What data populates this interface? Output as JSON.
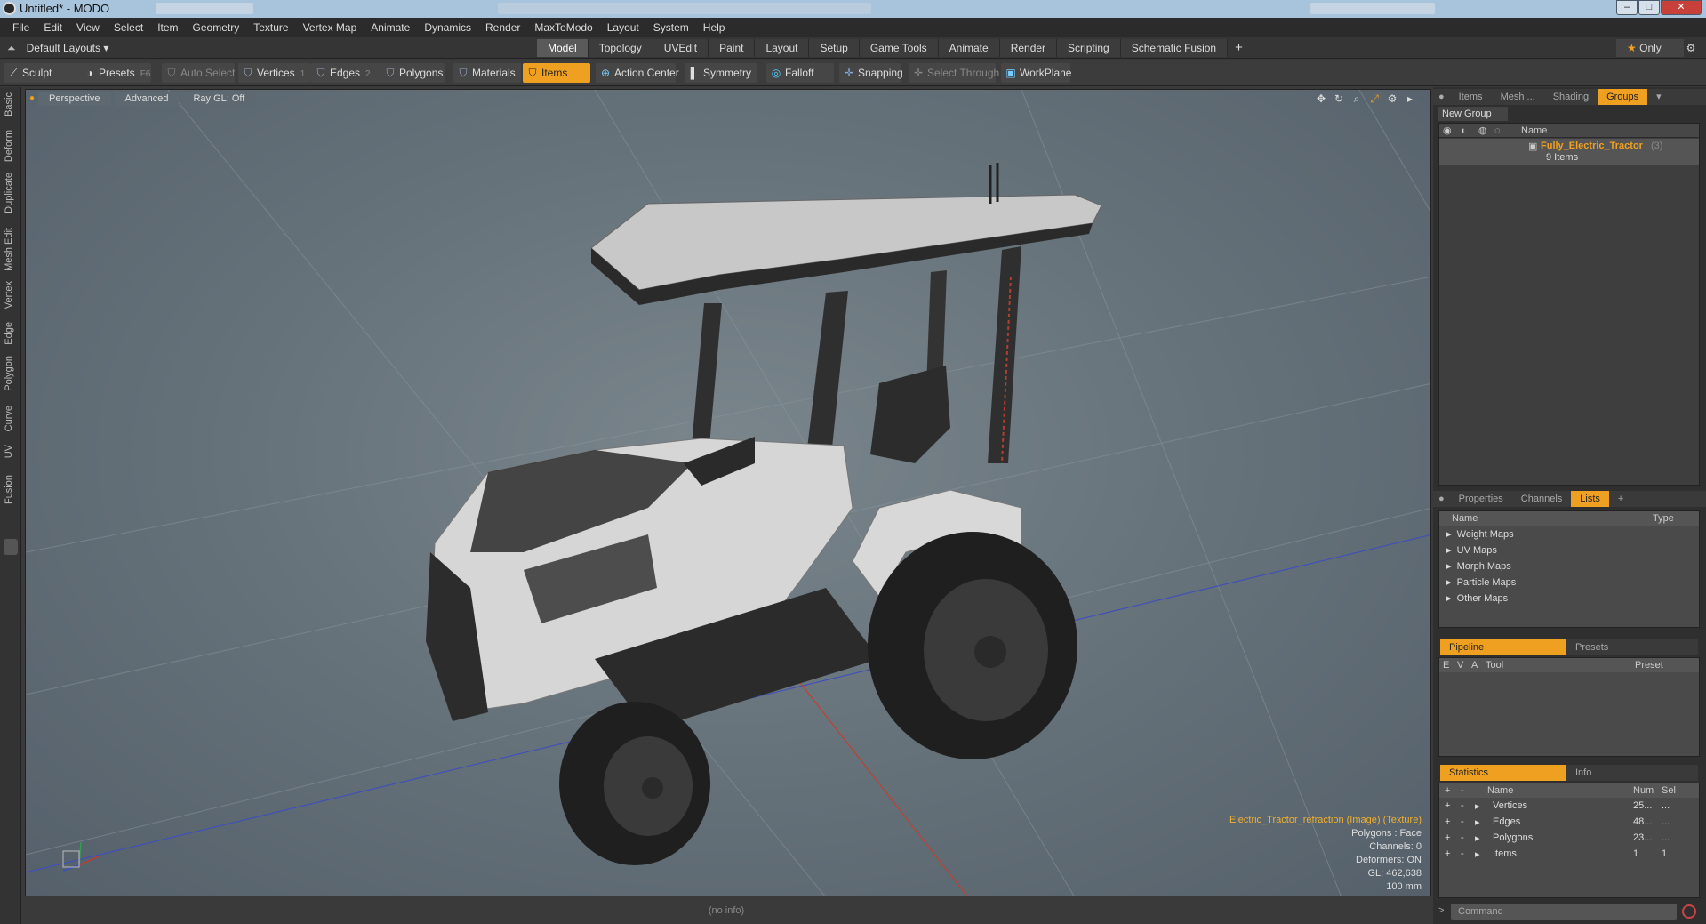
{
  "window": {
    "title": "Untitled* - MODO"
  },
  "menu": [
    "File",
    "Edit",
    "View",
    "Select",
    "Item",
    "Geometry",
    "Texture",
    "Vertex Map",
    "Animate",
    "Dynamics",
    "Render",
    "MaxToModo",
    "Layout",
    "System",
    "Help"
  ],
  "layout_selector": "Default Layouts",
  "tabs": [
    "Model",
    "Topology",
    "UVEdit",
    "Paint",
    "Layout",
    "Setup",
    "Game Tools",
    "Animate",
    "Render",
    "Scripting",
    "Schematic Fusion"
  ],
  "active_tab": "Model",
  "only_label": "Only",
  "toolbar": {
    "sculpt": "Sculpt",
    "presets": "Presets",
    "presets_key": "F6",
    "auto_select": "Auto Select",
    "vertices": "Vertices",
    "vertices_key": "1",
    "edges": "Edges",
    "edges_key": "2",
    "polygons": "Polygons",
    "materials": "Materials",
    "items": "Items",
    "action_center": "Action Center",
    "symmetry": "Symmetry",
    "falloff": "Falloff",
    "snapping": "Snapping",
    "select_through": "Select Through",
    "workplane": "WorkPlane"
  },
  "left_tabs": [
    "Basic",
    "Deform",
    "Duplicate",
    "Mesh Edit",
    "Vertex",
    "Edge",
    "Polygon",
    "Curve",
    "UV",
    "Fusion"
  ],
  "viewport": {
    "view": "Perspective",
    "advanced": "Advanced",
    "raygl": "Ray GL: Off",
    "info": {
      "texture": "Electric_Tractor_refraction (Image) (Texture)",
      "polygons": "Polygons : Face",
      "channels": "Channels: 0",
      "deformers": "Deformers: ON",
      "gl": "GL: 462,638",
      "units": "100 mm"
    }
  },
  "status": "(no info)",
  "groups_panel": {
    "tabs": [
      "Items",
      "Mesh ...",
      "Shading",
      "Groups"
    ],
    "active": "Groups",
    "new_group": "New Group",
    "col_name": "Name",
    "group_name": "Fully_Electric_Tractor",
    "group_count": "(3)",
    "group_items": "9 Items"
  },
  "lists_panel": {
    "tabs": [
      "Properties",
      "Channels",
      "Lists"
    ],
    "active": "Lists",
    "col_name": "Name",
    "col_type": "Type",
    "items": [
      "Weight Maps",
      "UV Maps",
      "Morph Maps",
      "Particle Maps",
      "Other Maps"
    ]
  },
  "pipeline_panel": {
    "tabs": [
      "Pipeline",
      "Presets"
    ],
    "cols": [
      "E",
      "V",
      "A",
      "Tool",
      "Preset"
    ]
  },
  "stats_panel": {
    "tabs": [
      "Statistics",
      "Info"
    ],
    "cols": [
      "Name",
      "Num",
      "Sel"
    ],
    "rows": [
      {
        "name": "Vertices",
        "num": "25...",
        "sel": "..."
      },
      {
        "name": "Edges",
        "num": "48...",
        "sel": "..."
      },
      {
        "name": "Polygons",
        "num": "23...",
        "sel": "..."
      },
      {
        "name": "Items",
        "num": "1",
        "sel": "1"
      }
    ]
  },
  "command": {
    "placeholder": "Command"
  },
  "colors": {
    "accent": "#f0a020",
    "viewport_bg": "#66727a",
    "panel_bg": "#4a4a4a"
  }
}
